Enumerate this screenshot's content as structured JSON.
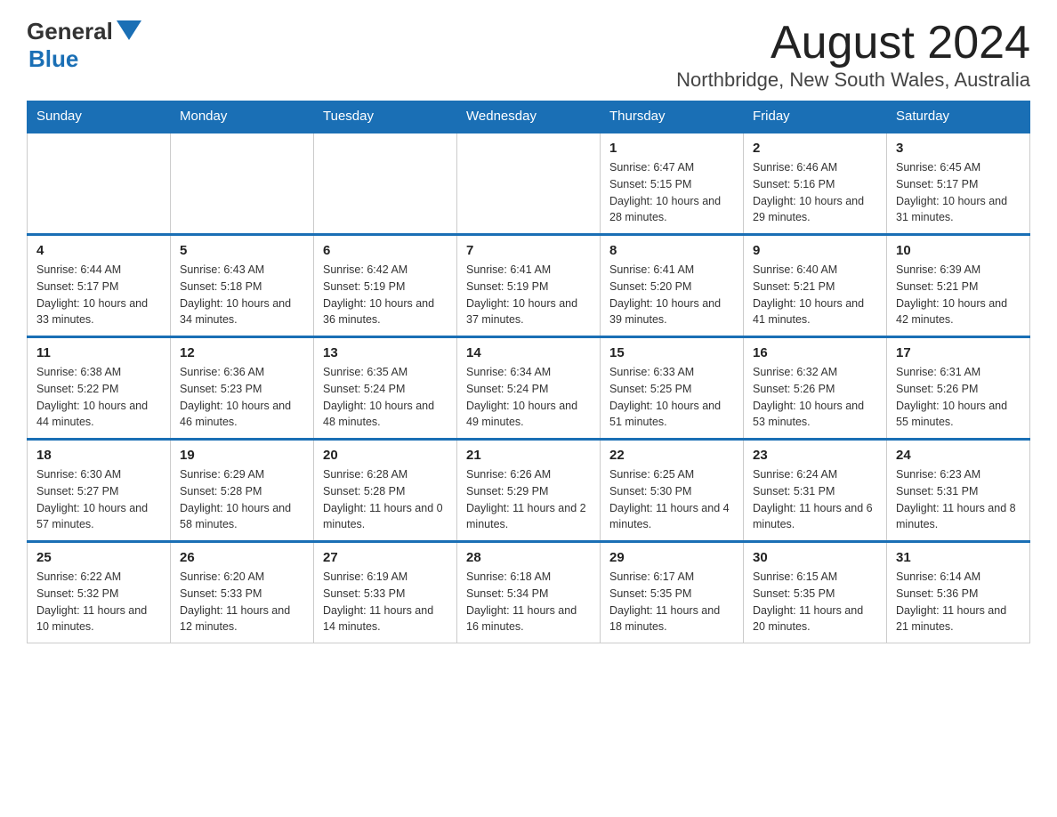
{
  "logo": {
    "text_general": "General",
    "text_blue": "Blue"
  },
  "title": "August 2024",
  "subtitle": "Northbridge, New South Wales, Australia",
  "weekdays": [
    "Sunday",
    "Monday",
    "Tuesday",
    "Wednesday",
    "Thursday",
    "Friday",
    "Saturday"
  ],
  "weeks": [
    [
      {
        "day": "",
        "info": ""
      },
      {
        "day": "",
        "info": ""
      },
      {
        "day": "",
        "info": ""
      },
      {
        "day": "",
        "info": ""
      },
      {
        "day": "1",
        "info": "Sunrise: 6:47 AM\nSunset: 5:15 PM\nDaylight: 10 hours and 28 minutes."
      },
      {
        "day": "2",
        "info": "Sunrise: 6:46 AM\nSunset: 5:16 PM\nDaylight: 10 hours and 29 minutes."
      },
      {
        "day": "3",
        "info": "Sunrise: 6:45 AM\nSunset: 5:17 PM\nDaylight: 10 hours and 31 minutes."
      }
    ],
    [
      {
        "day": "4",
        "info": "Sunrise: 6:44 AM\nSunset: 5:17 PM\nDaylight: 10 hours and 33 minutes."
      },
      {
        "day": "5",
        "info": "Sunrise: 6:43 AM\nSunset: 5:18 PM\nDaylight: 10 hours and 34 minutes."
      },
      {
        "day": "6",
        "info": "Sunrise: 6:42 AM\nSunset: 5:19 PM\nDaylight: 10 hours and 36 minutes."
      },
      {
        "day": "7",
        "info": "Sunrise: 6:41 AM\nSunset: 5:19 PM\nDaylight: 10 hours and 37 minutes."
      },
      {
        "day": "8",
        "info": "Sunrise: 6:41 AM\nSunset: 5:20 PM\nDaylight: 10 hours and 39 minutes."
      },
      {
        "day": "9",
        "info": "Sunrise: 6:40 AM\nSunset: 5:21 PM\nDaylight: 10 hours and 41 minutes."
      },
      {
        "day": "10",
        "info": "Sunrise: 6:39 AM\nSunset: 5:21 PM\nDaylight: 10 hours and 42 minutes."
      }
    ],
    [
      {
        "day": "11",
        "info": "Sunrise: 6:38 AM\nSunset: 5:22 PM\nDaylight: 10 hours and 44 minutes."
      },
      {
        "day": "12",
        "info": "Sunrise: 6:36 AM\nSunset: 5:23 PM\nDaylight: 10 hours and 46 minutes."
      },
      {
        "day": "13",
        "info": "Sunrise: 6:35 AM\nSunset: 5:24 PM\nDaylight: 10 hours and 48 minutes."
      },
      {
        "day": "14",
        "info": "Sunrise: 6:34 AM\nSunset: 5:24 PM\nDaylight: 10 hours and 49 minutes."
      },
      {
        "day": "15",
        "info": "Sunrise: 6:33 AM\nSunset: 5:25 PM\nDaylight: 10 hours and 51 minutes."
      },
      {
        "day": "16",
        "info": "Sunrise: 6:32 AM\nSunset: 5:26 PM\nDaylight: 10 hours and 53 minutes."
      },
      {
        "day": "17",
        "info": "Sunrise: 6:31 AM\nSunset: 5:26 PM\nDaylight: 10 hours and 55 minutes."
      }
    ],
    [
      {
        "day": "18",
        "info": "Sunrise: 6:30 AM\nSunset: 5:27 PM\nDaylight: 10 hours and 57 minutes."
      },
      {
        "day": "19",
        "info": "Sunrise: 6:29 AM\nSunset: 5:28 PM\nDaylight: 10 hours and 58 minutes."
      },
      {
        "day": "20",
        "info": "Sunrise: 6:28 AM\nSunset: 5:28 PM\nDaylight: 11 hours and 0 minutes."
      },
      {
        "day": "21",
        "info": "Sunrise: 6:26 AM\nSunset: 5:29 PM\nDaylight: 11 hours and 2 minutes."
      },
      {
        "day": "22",
        "info": "Sunrise: 6:25 AM\nSunset: 5:30 PM\nDaylight: 11 hours and 4 minutes."
      },
      {
        "day": "23",
        "info": "Sunrise: 6:24 AM\nSunset: 5:31 PM\nDaylight: 11 hours and 6 minutes."
      },
      {
        "day": "24",
        "info": "Sunrise: 6:23 AM\nSunset: 5:31 PM\nDaylight: 11 hours and 8 minutes."
      }
    ],
    [
      {
        "day": "25",
        "info": "Sunrise: 6:22 AM\nSunset: 5:32 PM\nDaylight: 11 hours and 10 minutes."
      },
      {
        "day": "26",
        "info": "Sunrise: 6:20 AM\nSunset: 5:33 PM\nDaylight: 11 hours and 12 minutes."
      },
      {
        "day": "27",
        "info": "Sunrise: 6:19 AM\nSunset: 5:33 PM\nDaylight: 11 hours and 14 minutes."
      },
      {
        "day": "28",
        "info": "Sunrise: 6:18 AM\nSunset: 5:34 PM\nDaylight: 11 hours and 16 minutes."
      },
      {
        "day": "29",
        "info": "Sunrise: 6:17 AM\nSunset: 5:35 PM\nDaylight: 11 hours and 18 minutes."
      },
      {
        "day": "30",
        "info": "Sunrise: 6:15 AM\nSunset: 5:35 PM\nDaylight: 11 hours and 20 minutes."
      },
      {
        "day": "31",
        "info": "Sunrise: 6:14 AM\nSunset: 5:36 PM\nDaylight: 11 hours and 21 minutes."
      }
    ]
  ]
}
